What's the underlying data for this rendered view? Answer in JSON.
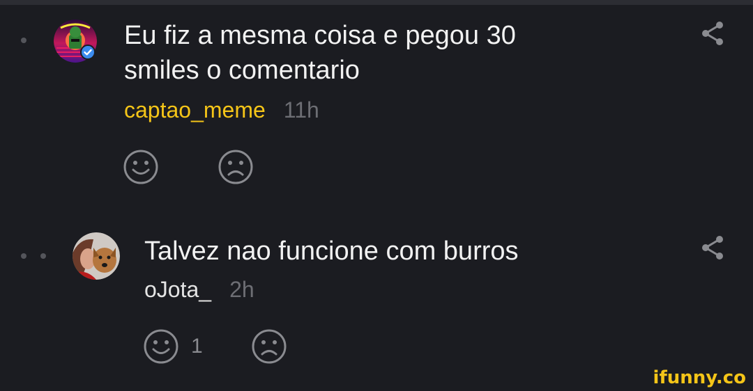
{
  "comments": [
    {
      "text_line1": "Eu fiz a mesma coisa e pegou 30",
      "text_line2": "smiles o comentario",
      "username": "captao_meme",
      "time": "11h",
      "smile_count": "",
      "username_color": "#f5c518",
      "verified": true
    },
    {
      "text_line1": "Talvez nao funcione com burros",
      "username": "oJota_",
      "time": "2h",
      "smile_count": "1",
      "username_color": "#e4e4e4"
    }
  ],
  "watermark": "ifunny.co",
  "icons": {
    "share": "share-icon",
    "smile": "smile-icon",
    "unsmile": "frown-icon",
    "verified": "verified-badge-icon"
  },
  "colors": {
    "background": "#1b1c21",
    "accent": "#f5c518",
    "verified": "#3b8cf0"
  }
}
